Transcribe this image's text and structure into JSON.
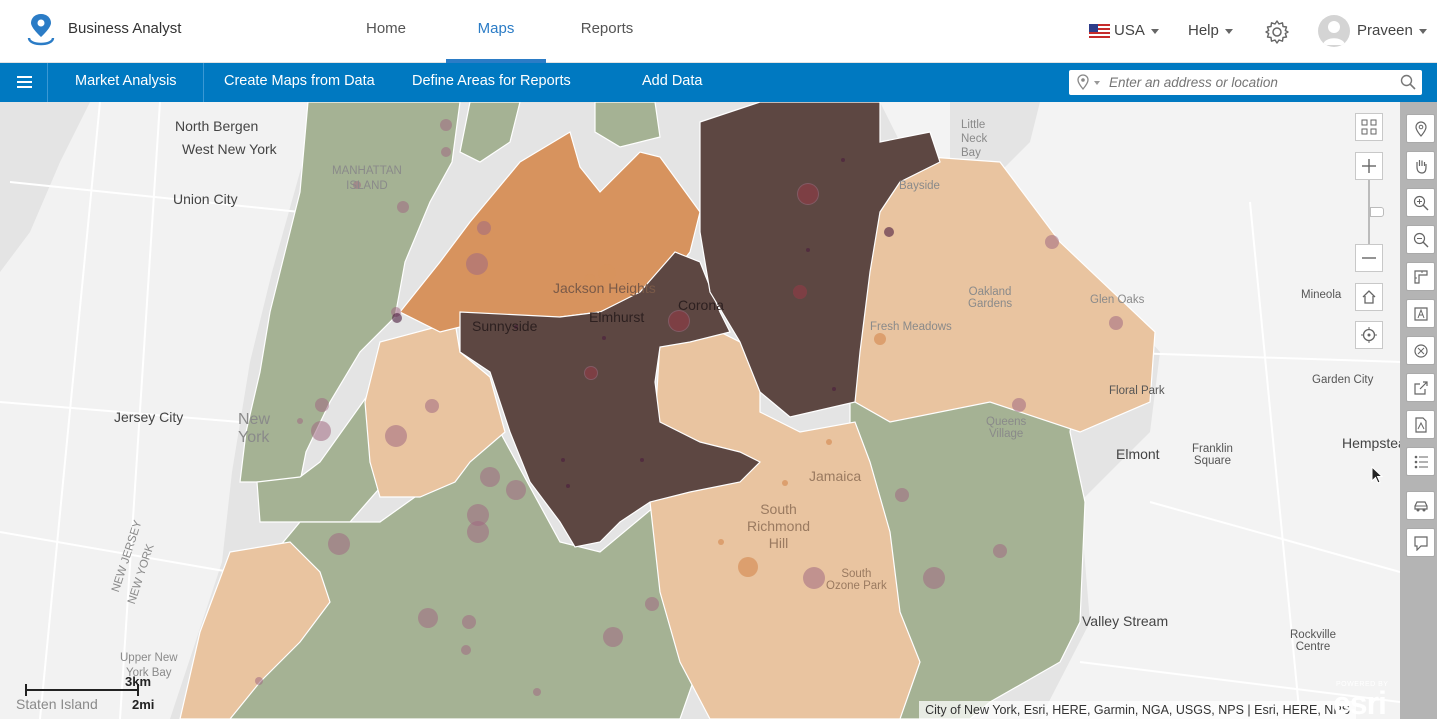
{
  "header": {
    "app_title": "Business Analyst",
    "tabs": [
      {
        "label": "Home",
        "active": false
      },
      {
        "label": "Maps",
        "active": true
      },
      {
        "label": "Reports",
        "active": false
      }
    ],
    "country": "USA",
    "help": "Help",
    "user": "Praveen",
    "icons": [
      "business-analyst-logo-icon",
      "us-flag-icon",
      "gear-icon",
      "avatar-icon"
    ]
  },
  "toolbar": {
    "items": [
      "Market Analysis",
      "Create Maps from Data",
      "Define Areas for Reports",
      "Add Data"
    ],
    "search_placeholder": "Enter an address or location"
  },
  "map": {
    "labels": {
      "north_bergen": "North Bergen",
      "west_new_york": "West New York",
      "union_city": "Union City",
      "jersey_city": "Jersey City",
      "new_york": "New\nYork",
      "manhattan": "MANHATTAN\nISLAND",
      "little_neck_bay": "Little\nNeck\nBay",
      "bayside": "Bayside",
      "jackson_heights": "Jackson Heights",
      "corona": "Corona",
      "sunnyside": "Sunnyside",
      "elmhurst": "Elmhurst",
      "oakland_gardens": "Oakland\nGardens",
      "glen_oaks": "Glen Oaks",
      "fresh_meadows": "Fresh Meadows",
      "mineola": "Mineola",
      "floral_park": "Floral Park",
      "garden_city": "Garden City",
      "queens_village": "Queens\nVillage",
      "elmont": "Elmont",
      "franklin_square": "Franklin\nSquare",
      "hempstead": "Hempstead",
      "jamaica": "Jamaica",
      "south_richmond_hill": "South\nRichmond\nHill",
      "south_ozone_park": "South\nOzone Park",
      "valley_stream": "Valley Stream",
      "rockville_centre": "Rockville\nCentre",
      "new_jersey": "NEW JERSEY",
      "new_york_state": "NEW YORK",
      "upper_new_york_bay": "Upper New\nYork Bay",
      "staten_island": "Staten Island"
    },
    "scale": {
      "km": "3km",
      "mi": "2mi"
    },
    "attribution": "City of New York, Esri, HERE, Garmin, NGA, USGS, NPS | Esri, HERE, NPS",
    "powered_by": "POWERED BY",
    "esri": "esri",
    "colors": {
      "water": "#e4e4e4",
      "land": "#f3f3f3",
      "green": "#a5b294",
      "tan": "#e9c4a0",
      "orange": "#d7935e",
      "dark": "#5d4742",
      "bubble": "#a06a82"
    }
  },
  "map_controls": [
    "grid-icon",
    "zoom-in-icon",
    "zoom-slider",
    "zoom-out-icon",
    "home-icon",
    "locate-icon"
  ],
  "tools": [
    "location-pin-icon",
    "pan-hand-icon",
    "zoom-in-tool-icon",
    "zoom-out-tool-icon",
    "measure-icon",
    "label-icon",
    "clear-icon",
    "export-icon",
    "pdf-icon",
    "legend-icon",
    "car-icon",
    "note-icon"
  ]
}
